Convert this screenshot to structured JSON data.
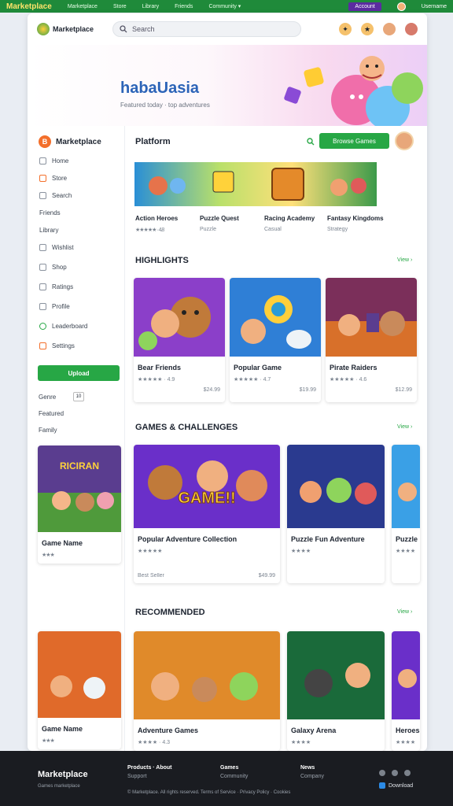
{
  "topbar": {
    "brand": "Marketplace",
    "links": [
      "Marketplace",
      "Store",
      "Library",
      "Friends",
      "Community ▾"
    ],
    "pill": "Account",
    "user": "Username"
  },
  "header": {
    "logo": "Marketplace",
    "search_placeholder": "Search"
  },
  "hero": {
    "title": "habaUasia",
    "subtitle": "Featured today · top adventures"
  },
  "sidebar": {
    "title": "Marketplace",
    "items": [
      "Home",
      "Store",
      "Search",
      "Friends",
      "Library",
      "Wishlist",
      "Shop",
      "Ratings",
      "Profile",
      "Leaderboard",
      "Settings"
    ],
    "button": "Upload",
    "filters": [
      "Genre",
      "Featured",
      "Family"
    ],
    "filter_badge": "10",
    "card_title": "Game Name",
    "card_stars": "★★★"
  },
  "featured": {
    "title": "Platform",
    "button": "Browse Games",
    "items": [
      {
        "title": "Action Heroes",
        "meta": "★★★★★ ·  4.8"
      },
      {
        "title": "Puzzle Quest",
        "meta": "Puzzle"
      },
      {
        "title": "Racing Academy",
        "meta": "Casual"
      },
      {
        "title": "Fantasy Kingdoms",
        "meta": "Strategy"
      }
    ]
  },
  "section1": {
    "title": "HIGHLIGHTS",
    "see_all": "View ›",
    "cards": [
      {
        "title": "Bear Friends",
        "meta": "★★★★★ · 4.9",
        "price": "$24.99"
      },
      {
        "title": "Popular Game",
        "meta": "★★★★★ · 4.7",
        "price": "$19.99"
      },
      {
        "title": "Pirate Raiders",
        "meta": "★★★★★ · 4.6",
        "price": "$12.99"
      }
    ]
  },
  "section2": {
    "title": "GAMES & CHALLENGES",
    "see_all": "View ›",
    "banner": "GAME!!",
    "cards": [
      {
        "title": "Popular Adventure Collection",
        "meta": "★★★★★",
        "extra": "Best Seller",
        "price": "$49.99"
      },
      {
        "title": "Puzzle Fun Adventure",
        "meta": "★★★★"
      },
      {
        "title": "Puzzle",
        "meta": "★★★★"
      }
    ]
  },
  "section3": {
    "title": "RECOMMENDED",
    "see_all": "View ›",
    "cards": [
      {
        "title": "Game Name",
        "meta": "★★★"
      },
      {
        "title": "Adventure Games",
        "meta": "★★★★ · 4.3"
      },
      {
        "title": "Galaxy Arena",
        "meta": "★★★★"
      },
      {
        "title": "Heroes",
        "meta": "★★★★"
      }
    ]
  },
  "footer": {
    "brand": "Marketplace",
    "tagline": "Games marketplace",
    "cols": [
      {
        "h": "Products · About",
        "s": "Support"
      },
      {
        "h": "Games",
        "s": "Community"
      },
      {
        "h": "News",
        "s": "Company"
      }
    ],
    "copyright": "© Marketplace. All rights reserved. Terms of Service · Privacy Policy · Cookies",
    "app": "Download"
  },
  "colors": {
    "green": "#27a745",
    "brand_yellow": "#ffe46a",
    "footer": "#1a1c21"
  }
}
